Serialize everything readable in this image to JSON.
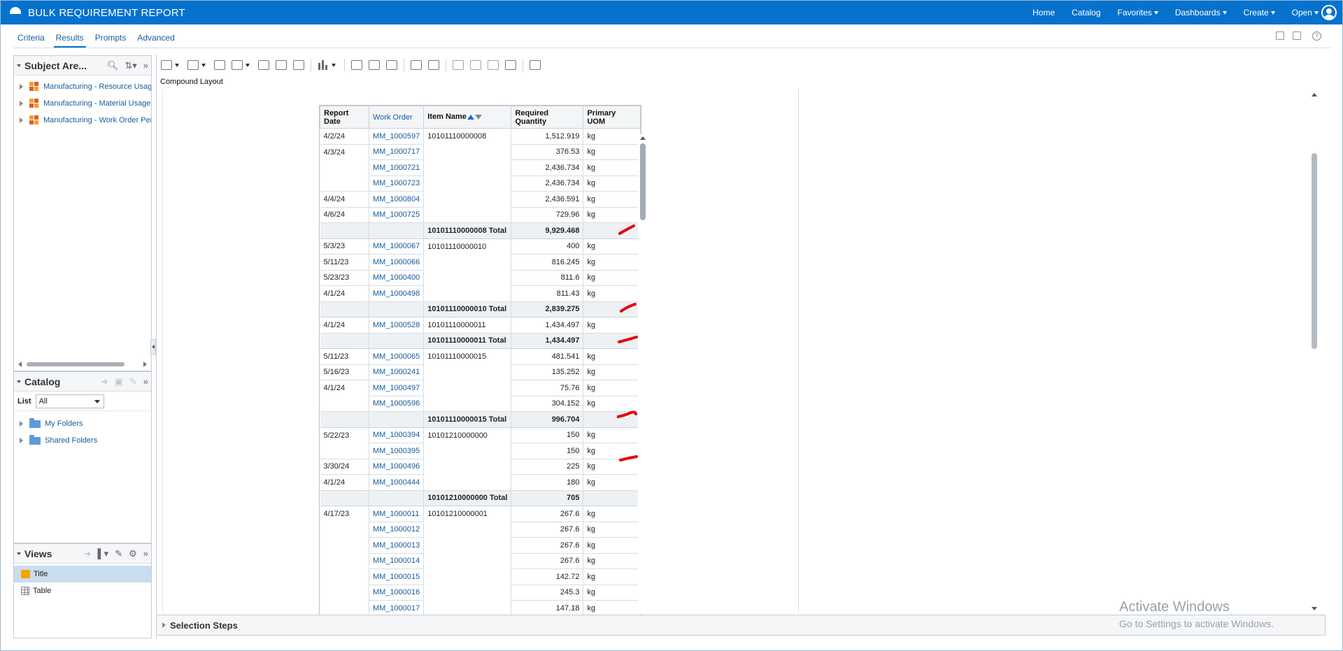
{
  "app": {
    "title": "BULK REQUIREMENT REPORT"
  },
  "topnav": [
    {
      "label": "Home",
      "dropdown": false
    },
    {
      "label": "Catalog",
      "dropdown": false
    },
    {
      "label": "Favorites",
      "dropdown": true
    },
    {
      "label": "Dashboards",
      "dropdown": true
    },
    {
      "label": "Create",
      "dropdown": true
    },
    {
      "label": "Open",
      "dropdown": true
    }
  ],
  "tabs": [
    "Criteria",
    "Results",
    "Prompts",
    "Advanced"
  ],
  "active_tab": "Results",
  "subject_areas": {
    "title": "Subject Are...",
    "items": [
      "Manufacturing - Resource Usage",
      "Manufacturing - Material Usage",
      "Manufacturing - Work Order Performance"
    ]
  },
  "catalog": {
    "title": "Catalog",
    "list_label": "List",
    "list_value": "All",
    "folders": [
      "My Folders",
      "Shared Folders"
    ]
  },
  "views": {
    "title": "Views",
    "items": [
      "Title",
      "Table"
    ],
    "selected": "Title"
  },
  "main": {
    "compound_label": "Compound Layout"
  },
  "report_table": {
    "headers": {
      "report_date": "Report Date",
      "work_order": "Work Order",
      "item_name": "Item Name",
      "required_qty_1": "Required",
      "required_qty_2": "Quantity",
      "uom_1": "Primary",
      "uom_2": "UOM"
    },
    "rows": [
      {
        "date": "4/2/24",
        "wo": "MM_1000597",
        "item": "10101110000008",
        "qty": "1,512.919",
        "uom": "kg"
      },
      {
        "date": "4/3/24",
        "wo": "MM_1000717",
        "item": "",
        "qty": "376.53",
        "uom": "kg"
      },
      {
        "date": "",
        "wo": "MM_1000721",
        "item": "",
        "qty": "2,436.734",
        "uom": "kg"
      },
      {
        "date": "",
        "wo": "MM_1000723",
        "item": "",
        "qty": "2,436.734",
        "uom": "kg"
      },
      {
        "date": "4/4/24",
        "wo": "MM_1000804",
        "item": "",
        "qty": "2,436.591",
        "uom": "kg"
      },
      {
        "date": "4/6/24",
        "wo": "MM_1000725",
        "item": "",
        "qty": "729.96",
        "uom": "kg"
      },
      {
        "total": true,
        "item": "10101110000008 Total",
        "qty": "9,929.468"
      },
      {
        "date": "5/3/23",
        "wo": "MM_1000067",
        "item": "10101110000010",
        "qty": "400",
        "uom": "kg"
      },
      {
        "date": "5/11/23",
        "wo": "MM_1000066",
        "item": "",
        "qty": "816.245",
        "uom": "kg"
      },
      {
        "date": "5/23/23",
        "wo": "MM_1000400",
        "item": "",
        "qty": "811.6",
        "uom": "kg"
      },
      {
        "date": "4/1/24",
        "wo": "MM_1000498",
        "item": "",
        "qty": "811.43",
        "uom": "kg"
      },
      {
        "total": true,
        "item": "10101110000010 Total",
        "qty": "2,839.275"
      },
      {
        "date": "4/1/24",
        "wo": "MM_1000528",
        "item": "10101110000011",
        "qty": "1,434.497",
        "uom": "kg"
      },
      {
        "total": true,
        "item": "10101110000011 Total",
        "qty": "1,434.497"
      },
      {
        "date": "5/11/23",
        "wo": "MM_1000065",
        "item": "10101110000015",
        "qty": "481.541",
        "uom": "kg"
      },
      {
        "date": "5/16/23",
        "wo": "MM_1000241",
        "item": "",
        "qty": "135.252",
        "uom": "kg"
      },
      {
        "date": "4/1/24",
        "wo": "MM_1000497",
        "item": "",
        "qty": "75.76",
        "uom": "kg"
      },
      {
        "date": "",
        "wo": "MM_1000596",
        "item": "",
        "qty": "304.152",
        "uom": "kg"
      },
      {
        "total": true,
        "item": "10101110000015 Total",
        "qty": "996.704"
      },
      {
        "date": "5/22/23",
        "wo": "MM_1000394",
        "item": "10101210000000",
        "qty": "150",
        "uom": "kg"
      },
      {
        "date": "",
        "wo": "MM_1000395",
        "item": "",
        "qty": "150",
        "uom": "kg"
      },
      {
        "date": "3/30/24",
        "wo": "MM_1000496",
        "item": "",
        "qty": "225",
        "uom": "kg"
      },
      {
        "date": "4/1/24",
        "wo": "MM_1000444",
        "item": "",
        "qty": "180",
        "uom": "kg"
      },
      {
        "total": true,
        "item": "10101210000000 Total",
        "qty": "705"
      },
      {
        "date": "4/17/23",
        "wo": "MM_1000011",
        "item": "10101210000001",
        "qty": "267.6",
        "uom": "kg"
      },
      {
        "date": "",
        "wo": "MM_1000012",
        "item": "",
        "qty": "267.6",
        "uom": "kg"
      },
      {
        "date": "",
        "wo": "MM_1000013",
        "item": "",
        "qty": "267.6",
        "uom": "kg"
      },
      {
        "date": "",
        "wo": "MM_1000014",
        "item": "",
        "qty": "267.6",
        "uom": "kg"
      },
      {
        "date": "",
        "wo": "MM_1000015",
        "item": "",
        "qty": "142.72",
        "uom": "kg"
      },
      {
        "date": "",
        "wo": "MM_1000016",
        "item": "",
        "qty": "245.3",
        "uom": "kg"
      },
      {
        "date": "",
        "wo": "MM_1000017",
        "item": "",
        "qty": "147.18",
        "uom": "kg"
      }
    ]
  },
  "bottom": {
    "selection_steps": "Selection Steps"
  },
  "watermark": {
    "line1": "Activate Windows",
    "line2": "Go to Settings to activate Windows."
  },
  "colors": {
    "topbar": "#0572ce",
    "link": "#145c9e",
    "annotation": "#e8000a",
    "selected_view": "#c8ddef"
  }
}
